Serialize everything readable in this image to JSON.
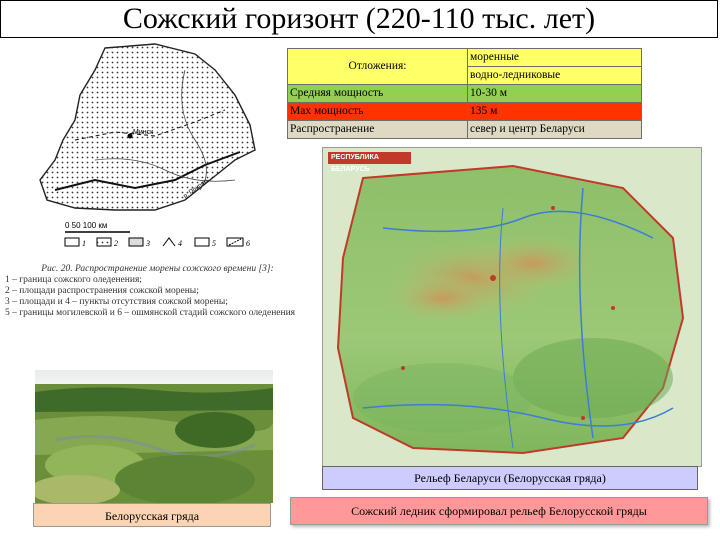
{
  "title": "Сожский горизонт (220-110 тыс. лет)",
  "table": {
    "deposits_label": "Отложения:",
    "deposits_values": [
      "моренные",
      "водно-ледниковые"
    ],
    "rows": [
      {
        "label": "Средняя мощность",
        "value": "10-30 м",
        "color": "#92d050"
      },
      {
        "label": "Мах мощность",
        "value": "135 м",
        "color": "#ff3300"
      },
      {
        "label": "Распространение",
        "value": "север и центр Беларуси",
        "color": "#ddd9c3"
      }
    ]
  },
  "scheme": {
    "scale_label": "0   50  100 км",
    "legend_numbers": [
      "1",
      "2",
      "3",
      "4",
      "5",
      "6"
    ],
    "caption_title": "Рис. 20. Распространение морены сожского времени [3]:",
    "caption_lines": [
      "1 – граница сожского оледенения;",
      "2 – площади распространения сожской морены;",
      "3 – площади и 4 – пункты отсутствия сожской морены;",
      "5 – границы могилевской и 6 – ошмянской стадий сожского оледенения"
    ],
    "city_label": "Минск",
    "river_label": "р. Припять"
  },
  "relief_map": {
    "header": "РЕСПУБЛИКА БЕЛАРУСЬ",
    "caption": "Рельеф Беларуси (Белорусская гряда)"
  },
  "ledge_caption": "Сожский ледник сформировал рельеф Белорусской гряды",
  "photo_caption": "Белорусская гряда"
}
